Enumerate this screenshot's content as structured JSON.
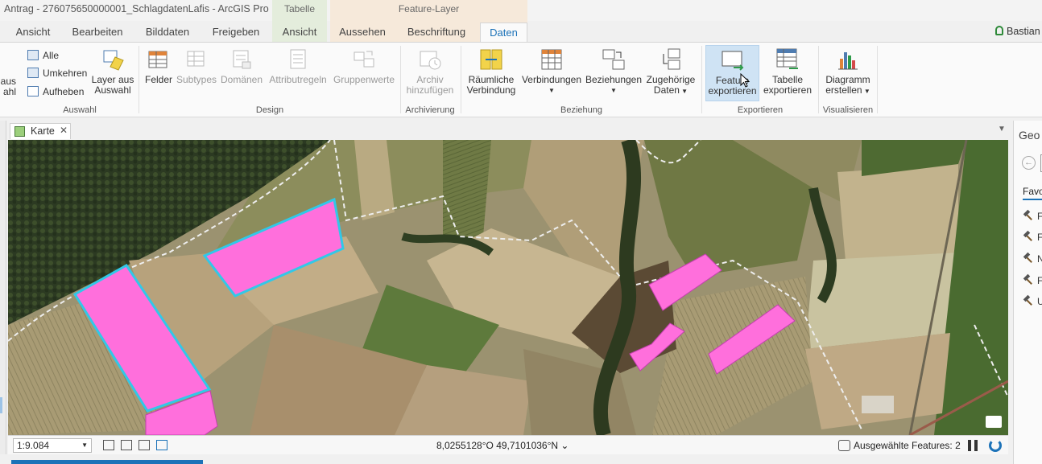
{
  "window": {
    "title": "Antrag - 276075650000001_SchlagdatenLafis - ArcGIS Pro",
    "context_groups": {
      "tabelle": "Tabelle",
      "feature_layer": "Feature-Layer"
    },
    "user": "Bastian"
  },
  "tabs": [
    {
      "label": "Ansicht"
    },
    {
      "label": "Bearbeiten"
    },
    {
      "label": "Bilddaten"
    },
    {
      "label": "Freigeben"
    },
    {
      "label": "Ansicht"
    },
    {
      "label": "Aussehen"
    },
    {
      "label": "Beschriftung"
    },
    {
      "label": "Daten",
      "active": true
    }
  ],
  "ribbon": {
    "selection": {
      "truncated_button": [
        "aus",
        "ahl"
      ],
      "alle": "Alle",
      "umkehren": "Umkehren",
      "aufheben": "Aufheben",
      "layer_aus_auswahl": [
        "Layer aus",
        "Auswahl"
      ],
      "group_label": "Auswahl"
    },
    "design": {
      "felder": "Felder",
      "subtypes": "Subtypes",
      "domaenen": "Domänen",
      "attributregeln": "Attributregeln",
      "gruppenwerte": "Gruppenwerte",
      "group_label": "Design"
    },
    "archiving": {
      "archiv": [
        "Archiv",
        "hinzufügen"
      ],
      "group_label": "Archivierung"
    },
    "relationship": {
      "raeumliche": [
        "Räumliche",
        "Verbindung"
      ],
      "verbindungen": "Verbindungen",
      "beziehungen": "Beziehungen",
      "zugehoerige": [
        "Zugehörige",
        "Daten"
      ],
      "group_label": "Beziehung"
    },
    "export": {
      "feature_export": [
        "Feature",
        "exportieren"
      ],
      "tabelle_export": [
        "Tabelle",
        "exportieren"
      ],
      "group_label": "Exportieren"
    },
    "visualize": {
      "diagramm": [
        "Diagramm",
        "erstellen"
      ],
      "group_label": "Visualisieren"
    }
  },
  "map_view": {
    "tab_label": "Karte",
    "accent_fill": "#ff6fdc",
    "selection_outline": "#31c8e8"
  },
  "statusbar": {
    "scale": "1:9.084",
    "coordinates": "8,0255128°O 49,7101036°N",
    "selected_features": "Ausgewählte Features: 2"
  },
  "right_pane": {
    "title": "Geo",
    "tab": "Favo",
    "tools": [
      "F",
      "F",
      "N",
      "F",
      "U"
    ]
  }
}
